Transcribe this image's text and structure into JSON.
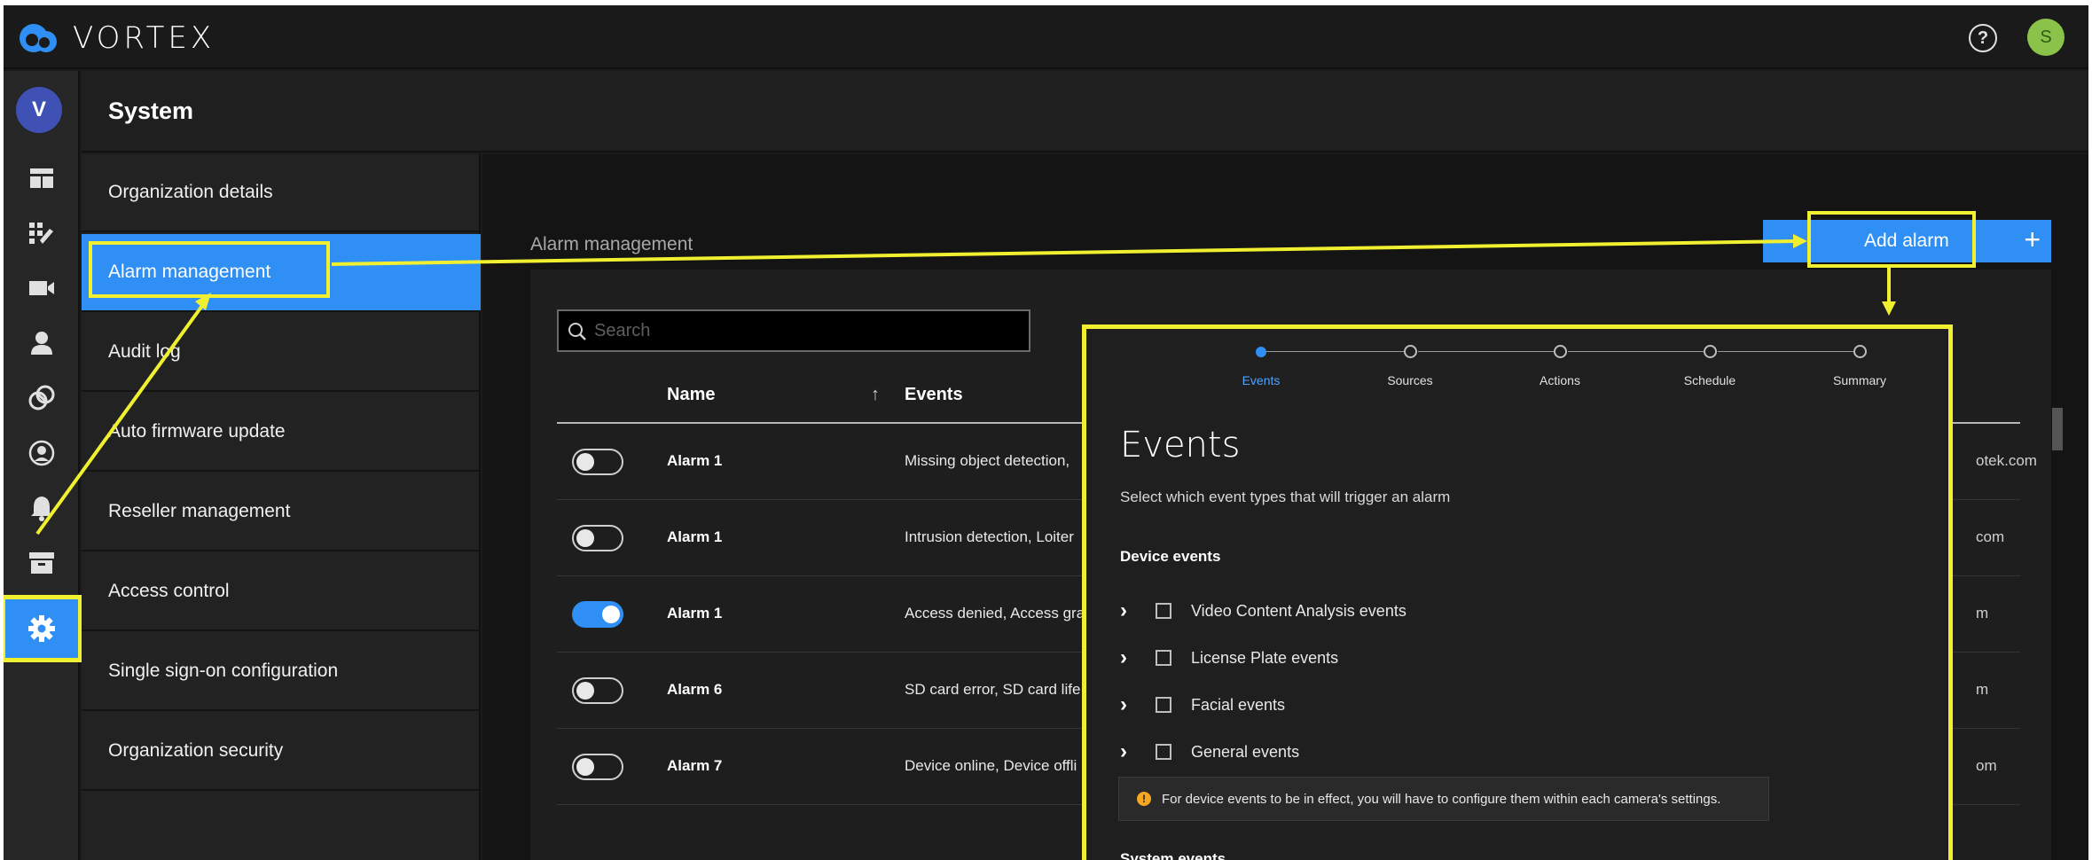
{
  "app": {
    "brand": "VORTEX"
  },
  "topbar": {
    "help_glyph": "?",
    "user_initial": "S"
  },
  "rail": {
    "org_initial": "V",
    "icons": [
      "dashboard-icon",
      "devices-icon",
      "camera-icon",
      "user-icon",
      "analytics-icon",
      "account-icon",
      "bell-icon",
      "archive-icon",
      "gear-icon"
    ]
  },
  "header": {
    "title": "System"
  },
  "menu": {
    "items": [
      {
        "label": "Organization details"
      },
      {
        "label": "Alarm management",
        "active": true
      },
      {
        "label": "Audit log"
      },
      {
        "label": "Auto firmware update"
      },
      {
        "label": "Reseller management"
      },
      {
        "label": "Access control"
      },
      {
        "label": "Single sign-on configuration"
      },
      {
        "label": "Organization security"
      }
    ]
  },
  "main": {
    "page_label": "Alarm management",
    "add_button": "Add alarm",
    "add_plus": "+",
    "search": {
      "placeholder": "Search"
    },
    "table": {
      "columns": {
        "name": "Name",
        "sort": "↑",
        "events": "Events"
      },
      "rows": [
        {
          "enabled": false,
          "name": "Alarm 1",
          "events": "Missing object detection,",
          "email": "otek.com"
        },
        {
          "enabled": false,
          "name": "Alarm 1",
          "events": "Intrusion detection, Loiter",
          "email": "com"
        },
        {
          "enabled": true,
          "name": "Alarm 1",
          "events": "Access denied, Access gra",
          "email": "m"
        },
        {
          "enabled": false,
          "name": "Alarm 6",
          "events": "SD card error, SD card life",
          "email": "m"
        },
        {
          "enabled": false,
          "name": "Alarm 7",
          "events": "Device online, Device offli",
          "email": "om"
        }
      ]
    }
  },
  "wizard": {
    "steps": [
      "Events",
      "Sources",
      "Actions",
      "Schedule",
      "Summary"
    ],
    "active_step": 0,
    "title": "Events",
    "subtitle": "Select which event types that will trigger an alarm",
    "device_section": "Device events",
    "device_events": [
      "Video Content Analysis events",
      "License Plate events",
      "Facial events",
      "General events"
    ],
    "note": "For device events to be in effect, you will have to configure them within each camera's settings.",
    "system_section": "System events"
  },
  "colors": {
    "accent": "#2f8ff5",
    "highlight": "#f0f030",
    "background": "#1b1b1b"
  }
}
